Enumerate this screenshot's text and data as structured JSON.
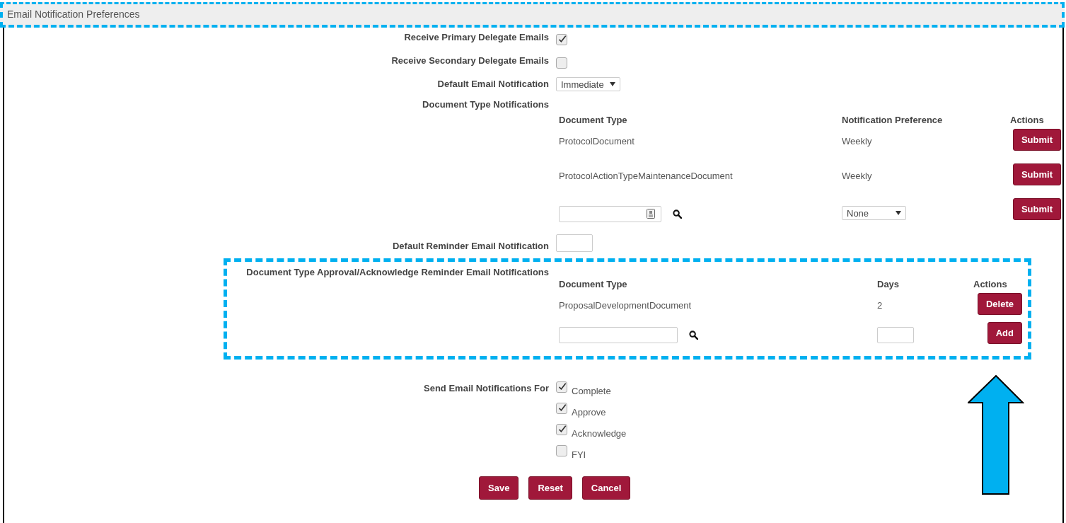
{
  "header": {
    "title": "Email Notification Preferences"
  },
  "fields": [
    {
      "kind": "checkbox",
      "label": "Receive Primary Delegate Emails",
      "checked": true
    },
    {
      "kind": "checkbox",
      "label": "Receive Secondary Delegate Emails",
      "checked": false
    },
    {
      "kind": "select",
      "label": "Default Email Notification",
      "value": "Immediate"
    }
  ],
  "document_type_notifications": {
    "label": "Document Type Notifications",
    "columns": [
      "Document Type",
      "Notification Preference",
      "Actions"
    ],
    "rows": [
      {
        "document_type": "ProtocolDocument",
        "preference": "Weekly",
        "action": "Submit"
      },
      {
        "document_type": "ProtocolActionTypeMaintenanceDocument",
        "preference": "Weekly",
        "action": "Submit"
      }
    ],
    "new_row": {
      "preference": "None",
      "action": "Submit"
    }
  },
  "default_reminder": {
    "label": "Default Reminder Email Notification"
  },
  "reminder_notifications": {
    "label": "Document Type Approval/Acknowledge Reminder Email Notifications",
    "columns": [
      "Document Type",
      "Days",
      "Actions"
    ],
    "rows": [
      {
        "document_type": "ProposalDevelopmentDocument",
        "days": "2",
        "action": "Delete"
      }
    ],
    "new_row": {
      "action": "Add"
    }
  },
  "send_notifications_for": {
    "label": "Send Email Notifications For",
    "options": [
      {
        "label": "Complete",
        "checked": true
      },
      {
        "label": "Approve",
        "checked": true
      },
      {
        "label": "Acknowledge",
        "checked": true
      },
      {
        "label": "FYI",
        "checked": false
      }
    ]
  },
  "buttons": [
    "Save",
    "Reset",
    "Cancel"
  ]
}
